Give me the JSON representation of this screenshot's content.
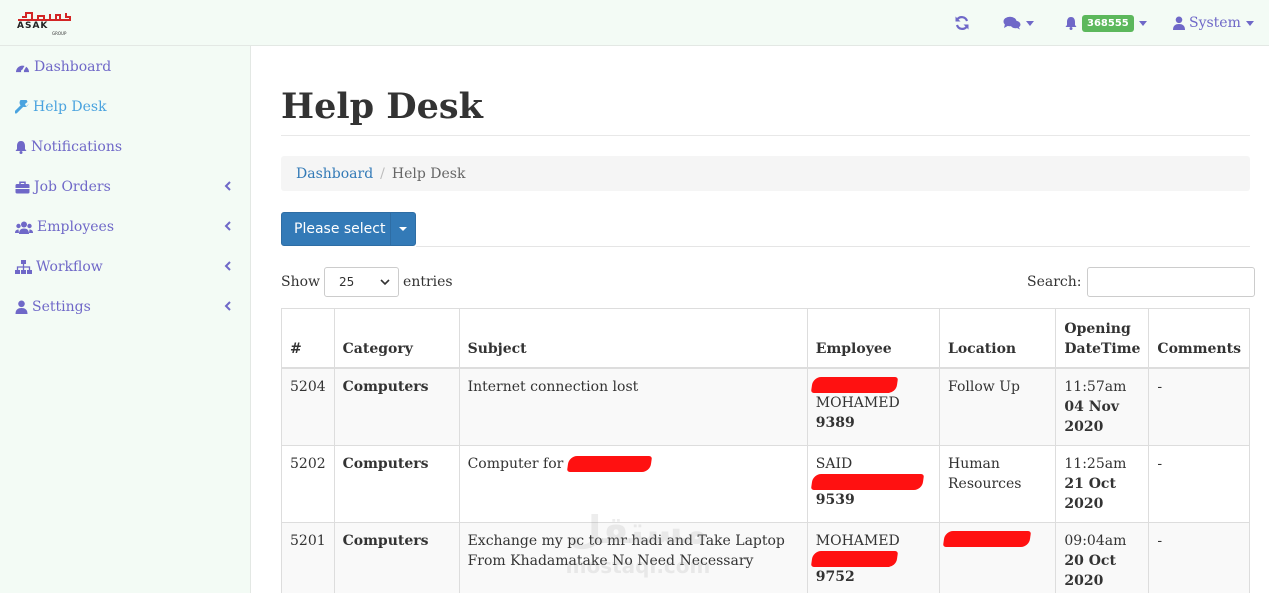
{
  "logo": {
    "arabic": "عساكر",
    "latin": "ASAK",
    "sub": "GROUP"
  },
  "topbar": {
    "refresh_icon": "refresh-icon",
    "messages_icon": "comments-icon",
    "notifications": {
      "icon": "bell-icon",
      "count": "368555"
    },
    "user": {
      "icon": "user-icon",
      "label": "System"
    }
  },
  "colors": {
    "nav": "#6f68c8",
    "active": "#4aa3df",
    "primary": "#337ab7",
    "badge": "#5cb85c",
    "sidebar_bg": "#f3fbf5",
    "redaction": "#ff1111"
  },
  "sidebar": {
    "items": [
      {
        "label": "Dashboard",
        "icon": "dashboard-icon",
        "submenu": false,
        "active": false
      },
      {
        "label": "Help Desk",
        "icon": "wrench-icon",
        "submenu": false,
        "active": true
      },
      {
        "label": "Notifications",
        "icon": "bell-icon",
        "submenu": false,
        "active": false
      },
      {
        "label": "Job Orders",
        "icon": "briefcase-icon",
        "submenu": true,
        "active": false
      },
      {
        "label": "Employees",
        "icon": "users-icon",
        "submenu": true,
        "active": false
      },
      {
        "label": "Workflow",
        "icon": "sitemap-icon",
        "submenu": true,
        "active": false
      },
      {
        "label": "Settings",
        "icon": "user-icon",
        "submenu": true,
        "active": false
      }
    ]
  },
  "main": {
    "title": "Help Desk",
    "breadcrumb": {
      "link": "Dashboard",
      "current": "Help Desk"
    },
    "select_button": "Please select",
    "length": {
      "show": "Show",
      "value": "25",
      "entries": "entries"
    },
    "search_label": "Search:",
    "search_value": ""
  },
  "table": {
    "headers": [
      "#",
      "Category",
      "Subject",
      "Employee",
      "Location",
      "Opening DateTime",
      "Comments"
    ],
    "rows": [
      {
        "id": "5204",
        "category": "Computers",
        "subject": "Internet connection lost",
        "employee_name": "MOHAMED",
        "employee_no": "9389",
        "location": "Follow Up",
        "time": "11:57am",
        "date": "04 Nov 2020",
        "comments": "-"
      },
      {
        "id": "5202",
        "category": "Computers",
        "subject": "Computer for",
        "employee_name": "SAID",
        "employee_no": "9539",
        "location": "Human Resources",
        "time": "11:25am",
        "date": "21 Oct 2020",
        "comments": "-"
      },
      {
        "id": "5201",
        "category": "Computers",
        "subject": "Exchange my pc to mr hadi and Take Laptop From Khadamatake No Need Necessary",
        "employee_name": "MOHAMED",
        "employee_no": "9752",
        "location": "",
        "time": "09:04am",
        "date": "20 Oct 2020",
        "comments": "-"
      }
    ]
  },
  "watermark": {
    "arabic": "مستقل",
    "latin": "mostaql.com"
  }
}
